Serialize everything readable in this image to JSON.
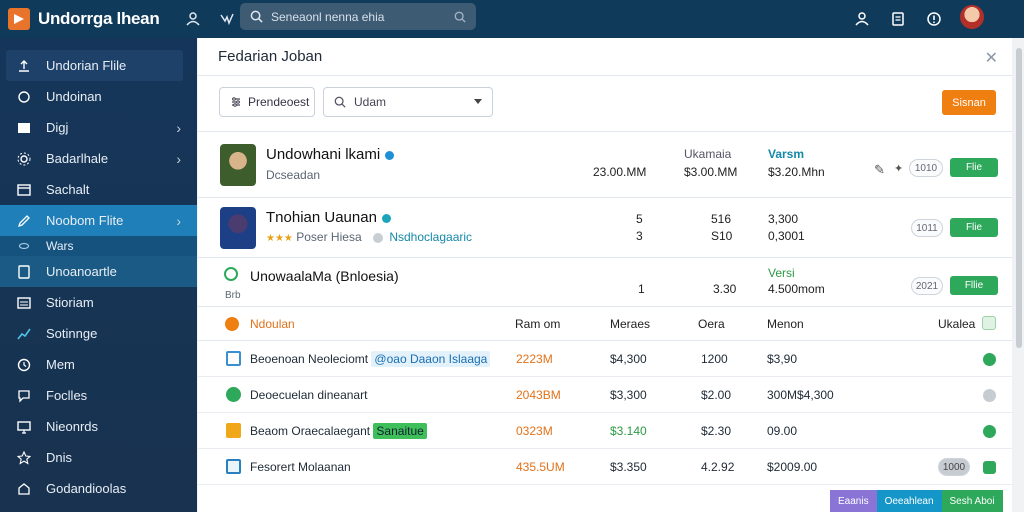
{
  "app": {
    "title": "Undorrga lhean"
  },
  "search": {
    "placeholder": "Seneaonl nenna ehia"
  },
  "sidebar": {
    "items": [
      {
        "label": "Undorian Flile"
      },
      {
        "label": "Undoinan"
      },
      {
        "label": "Digj"
      },
      {
        "label": "Badarlhale"
      },
      {
        "label": "Sachalt"
      },
      {
        "label": "Noobom Flite"
      },
      {
        "label": "Wars"
      },
      {
        "label": "Unoanoartle"
      },
      {
        "label": "Stioriam"
      },
      {
        "label": "Sotinnge"
      },
      {
        "label": "Mem"
      },
      {
        "label": "Foclles"
      },
      {
        "label": "Nieonrds"
      },
      {
        "label": "Dnis"
      },
      {
        "label": "Godandioolas"
      }
    ]
  },
  "panel": {
    "title": "Fedarian Joban",
    "preferences_label": "Prendeoest",
    "select_value": "Udam",
    "action_label": "Sisnan"
  },
  "cards": [
    {
      "name": "Undowhani lkami",
      "sub": "Dcseadan",
      "h1": "Ukamaia",
      "h2": "Varsm",
      "v0": "23.00.MM",
      "v1": "$3.00.MM",
      "v2": "$3.20.Mhn",
      "pill": "1010",
      "btn": "Flie"
    },
    {
      "name": "Tnohian Uaunan",
      "sub": "Poser Hiesa",
      "tag": "Nsdhoclagaaric",
      "v0a": "5",
      "v0b": "3",
      "v1a": "516",
      "v1b": "S10",
      "v2a": "3,300",
      "v2b": "0,3001",
      "pill": "1011",
      "btn": "Flie"
    },
    {
      "name": "UnowaalaMa (Bnloesia)",
      "sub": "Brb",
      "h2": "Versi",
      "v0": "1",
      "v1": "3.30",
      "v2": "4.500mom",
      "pill": "2021",
      "btn": "Fllie"
    }
  ],
  "table": {
    "header": {
      "name": "Ndoulan",
      "c1": "Ram om",
      "c2": "Meraes",
      "c3": "Oera",
      "c4": "Menon",
      "c5": "Ukalea"
    },
    "rows": [
      {
        "name": "Beoenoan Neoleciomt",
        "tag": "@oao Daaon Islaaga",
        "c1": "2223M",
        "c2": "$4,300",
        "c3": "1200",
        "c4": "$3,90"
      },
      {
        "name": "Deoecuelan dineanart",
        "c1": "2043BM",
        "c2": "$3,300",
        "c3": "$2.00",
        "c4": "300M$4,300"
      },
      {
        "name": "Beaom Oraecalaegant",
        "tag": "Sanaitue",
        "c1": "0323M",
        "c2": "$3.140",
        "c3": "$2.30",
        "c4": "09.00"
      },
      {
        "name": "Fesorert Molaanan",
        "c1": "435.5UM",
        "c2": "$3.350",
        "c3": "4.2.92",
        "c4": "$2009.00",
        "pill": "1000"
      }
    ]
  },
  "footer_tabs": [
    "Eaanis",
    "Oeeahlean",
    "Sesh Aboi"
  ],
  "colors": {
    "topbar": "#0f3a5a",
    "sidebar": "#15365a",
    "accent": "#1f7fb8",
    "orange": "#f07f12",
    "green": "#2ea85a"
  }
}
